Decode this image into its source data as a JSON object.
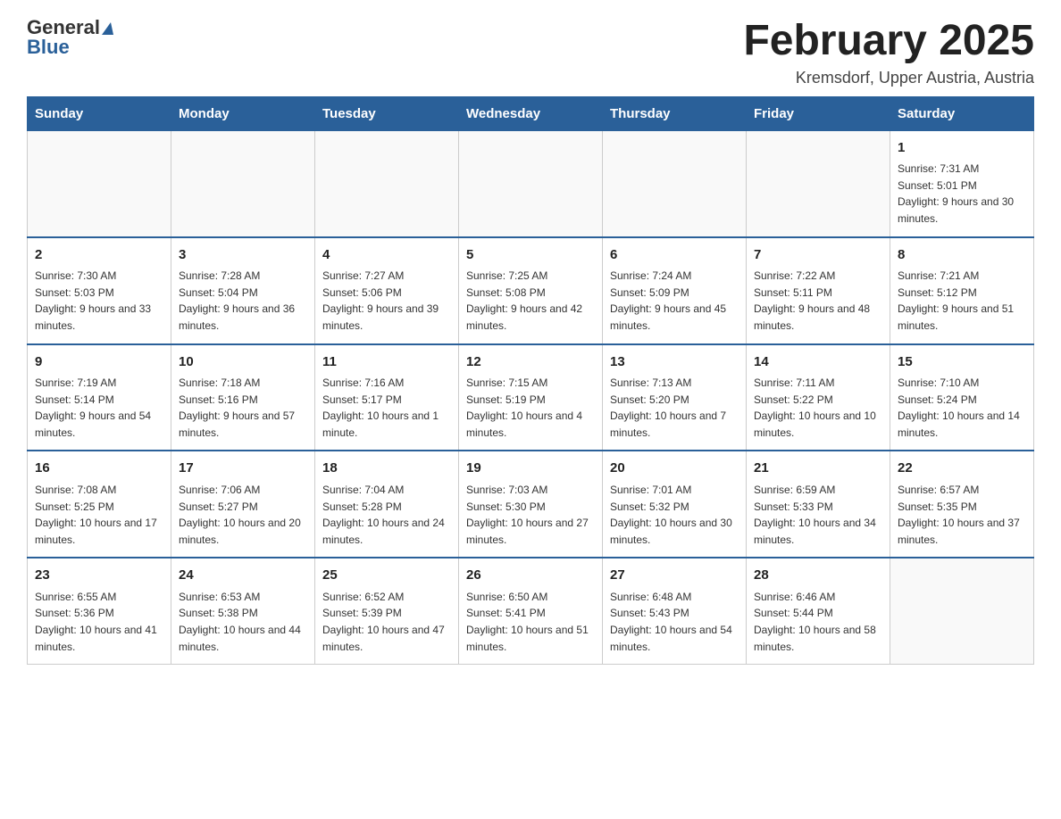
{
  "header": {
    "logo_general": "General",
    "logo_blue": "Blue",
    "month_title": "February 2025",
    "location": "Kremsdorf, Upper Austria, Austria"
  },
  "days_of_week": [
    "Sunday",
    "Monday",
    "Tuesday",
    "Wednesday",
    "Thursday",
    "Friday",
    "Saturday"
  ],
  "weeks": [
    [
      {
        "day": "",
        "info": ""
      },
      {
        "day": "",
        "info": ""
      },
      {
        "day": "",
        "info": ""
      },
      {
        "day": "",
        "info": ""
      },
      {
        "day": "",
        "info": ""
      },
      {
        "day": "",
        "info": ""
      },
      {
        "day": "1",
        "info": "Sunrise: 7:31 AM\nSunset: 5:01 PM\nDaylight: 9 hours and 30 minutes."
      }
    ],
    [
      {
        "day": "2",
        "info": "Sunrise: 7:30 AM\nSunset: 5:03 PM\nDaylight: 9 hours and 33 minutes."
      },
      {
        "day": "3",
        "info": "Sunrise: 7:28 AM\nSunset: 5:04 PM\nDaylight: 9 hours and 36 minutes."
      },
      {
        "day": "4",
        "info": "Sunrise: 7:27 AM\nSunset: 5:06 PM\nDaylight: 9 hours and 39 minutes."
      },
      {
        "day": "5",
        "info": "Sunrise: 7:25 AM\nSunset: 5:08 PM\nDaylight: 9 hours and 42 minutes."
      },
      {
        "day": "6",
        "info": "Sunrise: 7:24 AM\nSunset: 5:09 PM\nDaylight: 9 hours and 45 minutes."
      },
      {
        "day": "7",
        "info": "Sunrise: 7:22 AM\nSunset: 5:11 PM\nDaylight: 9 hours and 48 minutes."
      },
      {
        "day": "8",
        "info": "Sunrise: 7:21 AM\nSunset: 5:12 PM\nDaylight: 9 hours and 51 minutes."
      }
    ],
    [
      {
        "day": "9",
        "info": "Sunrise: 7:19 AM\nSunset: 5:14 PM\nDaylight: 9 hours and 54 minutes."
      },
      {
        "day": "10",
        "info": "Sunrise: 7:18 AM\nSunset: 5:16 PM\nDaylight: 9 hours and 57 minutes."
      },
      {
        "day": "11",
        "info": "Sunrise: 7:16 AM\nSunset: 5:17 PM\nDaylight: 10 hours and 1 minute."
      },
      {
        "day": "12",
        "info": "Sunrise: 7:15 AM\nSunset: 5:19 PM\nDaylight: 10 hours and 4 minutes."
      },
      {
        "day": "13",
        "info": "Sunrise: 7:13 AM\nSunset: 5:20 PM\nDaylight: 10 hours and 7 minutes."
      },
      {
        "day": "14",
        "info": "Sunrise: 7:11 AM\nSunset: 5:22 PM\nDaylight: 10 hours and 10 minutes."
      },
      {
        "day": "15",
        "info": "Sunrise: 7:10 AM\nSunset: 5:24 PM\nDaylight: 10 hours and 14 minutes."
      }
    ],
    [
      {
        "day": "16",
        "info": "Sunrise: 7:08 AM\nSunset: 5:25 PM\nDaylight: 10 hours and 17 minutes."
      },
      {
        "day": "17",
        "info": "Sunrise: 7:06 AM\nSunset: 5:27 PM\nDaylight: 10 hours and 20 minutes."
      },
      {
        "day": "18",
        "info": "Sunrise: 7:04 AM\nSunset: 5:28 PM\nDaylight: 10 hours and 24 minutes."
      },
      {
        "day": "19",
        "info": "Sunrise: 7:03 AM\nSunset: 5:30 PM\nDaylight: 10 hours and 27 minutes."
      },
      {
        "day": "20",
        "info": "Sunrise: 7:01 AM\nSunset: 5:32 PM\nDaylight: 10 hours and 30 minutes."
      },
      {
        "day": "21",
        "info": "Sunrise: 6:59 AM\nSunset: 5:33 PM\nDaylight: 10 hours and 34 minutes."
      },
      {
        "day": "22",
        "info": "Sunrise: 6:57 AM\nSunset: 5:35 PM\nDaylight: 10 hours and 37 minutes."
      }
    ],
    [
      {
        "day": "23",
        "info": "Sunrise: 6:55 AM\nSunset: 5:36 PM\nDaylight: 10 hours and 41 minutes."
      },
      {
        "day": "24",
        "info": "Sunrise: 6:53 AM\nSunset: 5:38 PM\nDaylight: 10 hours and 44 minutes."
      },
      {
        "day": "25",
        "info": "Sunrise: 6:52 AM\nSunset: 5:39 PM\nDaylight: 10 hours and 47 minutes."
      },
      {
        "day": "26",
        "info": "Sunrise: 6:50 AM\nSunset: 5:41 PM\nDaylight: 10 hours and 51 minutes."
      },
      {
        "day": "27",
        "info": "Sunrise: 6:48 AM\nSunset: 5:43 PM\nDaylight: 10 hours and 54 minutes."
      },
      {
        "day": "28",
        "info": "Sunrise: 6:46 AM\nSunset: 5:44 PM\nDaylight: 10 hours and 58 minutes."
      },
      {
        "day": "",
        "info": ""
      }
    ]
  ]
}
